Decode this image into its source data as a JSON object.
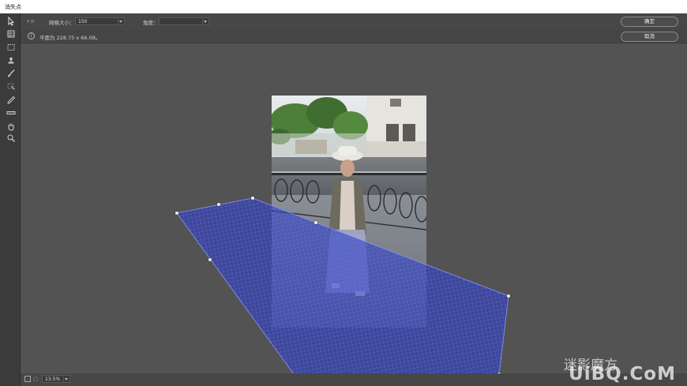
{
  "window": {
    "title": "消失点"
  },
  "options": {
    "grid_label": "网格大小：",
    "grid_value": "150",
    "angle_label": "角度：",
    "angle_value": "",
    "ok_label": "确定",
    "cancel_label": "取消"
  },
  "info": {
    "text": "平面为 228.75 x 66.08。"
  },
  "status": {
    "zoom": "13.5%"
  },
  "watermark": {
    "text": "UiBQ.CoM",
    "prefix": "迷影魔方"
  },
  "colors": {
    "accent": "#3a4fd8",
    "panel": "#474747",
    "canvas": "#535353"
  },
  "icons": [
    "edit-plane-tool-icon",
    "create-plane-tool-icon",
    "marquee-tool-icon",
    "stamp-tool-icon",
    "brush-tool-icon",
    "transform-tool-icon",
    "eyedropper-tool-icon",
    "measure-tool-icon",
    "hand-tool-icon",
    "zoom-tool-icon"
  ]
}
